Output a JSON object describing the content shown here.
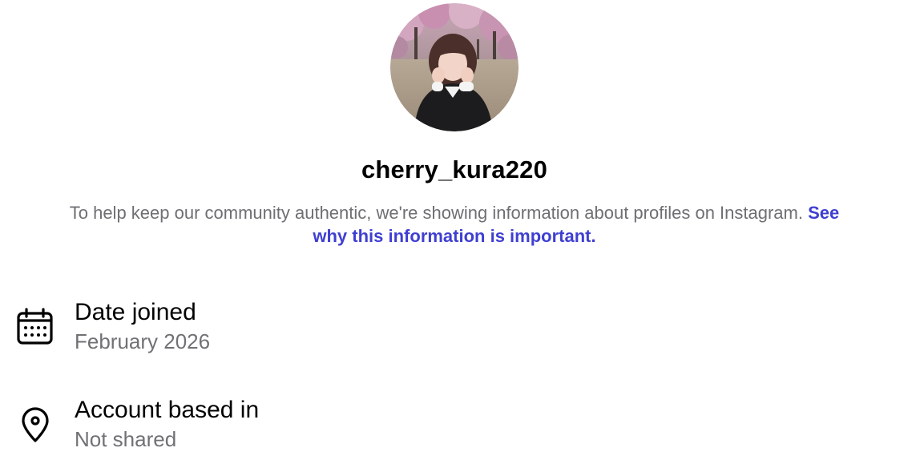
{
  "profile": {
    "username": "cherry_kura220",
    "avatar_icon": "profile-photo"
  },
  "info": {
    "text": "To help keep our community authentic, we're showing information about profiles on Instagram.",
    "link_text": "See why this information is important."
  },
  "details": {
    "date_joined": {
      "icon": "calendar-icon",
      "label": "Date joined",
      "value": "February 2026"
    },
    "account_based_in": {
      "icon": "location-pin-icon",
      "label": "Account based in",
      "value": "Not shared"
    }
  },
  "colors": {
    "link": "#3f3fd1",
    "secondary_text": "#6f6f73",
    "primary_text": "#000000"
  }
}
